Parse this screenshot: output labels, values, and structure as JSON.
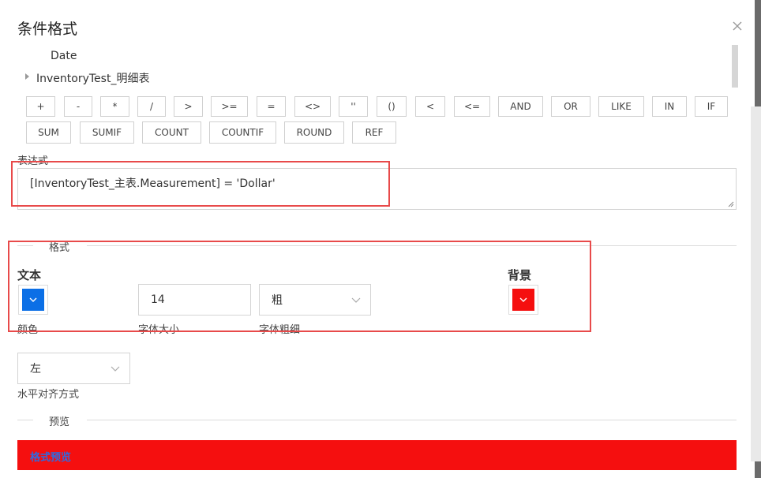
{
  "dialog": {
    "title": "条件格式"
  },
  "tree": {
    "items": [
      {
        "label": "Date"
      },
      {
        "label": "InventoryTest_明细表"
      }
    ]
  },
  "operators": [
    "+",
    "-",
    "*",
    "/",
    ">",
    ">=",
    "=",
    "<>",
    "''",
    "()",
    "<",
    "<=",
    "AND",
    "OR",
    "LIKE",
    "IN",
    "IF"
  ],
  "functions": [
    "SUM",
    "SUMIF",
    "COUNT",
    "COUNTIF",
    "ROUND",
    "REF"
  ],
  "expression": {
    "label": "表达式",
    "value": "[InventoryTest_主表.Measurement] =  'Dollar'"
  },
  "format": {
    "section_title": "格式",
    "text_heading": "文本",
    "background_heading": "背景",
    "color_label": "颜色",
    "font_size_label": "字体大小",
    "font_size_value": "14",
    "font_weight_label": "字体粗细",
    "font_weight_value": "粗",
    "align_label": "水平对齐方式",
    "align_value": "左",
    "text_color": "#0b6fe6",
    "background_color": "#f50f0f"
  },
  "preview": {
    "section_title": "预览",
    "sample_text": "格式预览",
    "background_color": "#f50f0f",
    "text_color": "#2f6be0"
  }
}
